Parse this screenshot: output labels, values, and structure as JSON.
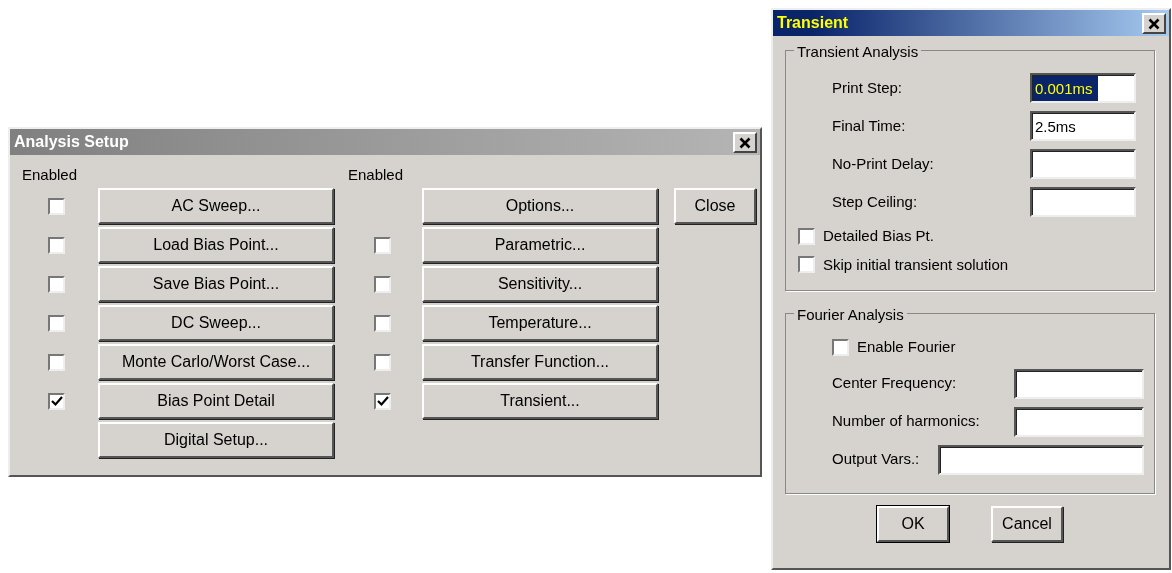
{
  "analysis_setup": {
    "title": "Analysis Setup",
    "left_column": {
      "header": "Enabled",
      "rows": [
        {
          "kind": "toggle",
          "label": "AC Sweep...",
          "checked": false
        },
        {
          "kind": "toggle",
          "label": "Load Bias Point...",
          "checked": false
        },
        {
          "kind": "toggle",
          "label": "Save Bias Point...",
          "checked": false
        },
        {
          "kind": "toggle",
          "label": "DC Sweep...",
          "checked": false
        },
        {
          "kind": "toggle",
          "label": "Monte Carlo/Worst Case...",
          "checked": false
        },
        {
          "kind": "toggle",
          "label": "Bias Point Detail",
          "checked": true
        },
        {
          "kind": "button",
          "label": "Digital Setup..."
        }
      ]
    },
    "right_column": {
      "header": "Enabled",
      "rows": [
        {
          "kind": "button",
          "label": "Options..."
        },
        {
          "kind": "toggle",
          "label": "Parametric...",
          "checked": false
        },
        {
          "kind": "toggle",
          "label": "Sensitivity...",
          "checked": false
        },
        {
          "kind": "toggle",
          "label": "Temperature...",
          "checked": false
        },
        {
          "kind": "toggle",
          "label": "Transfer Function...",
          "checked": false
        },
        {
          "kind": "toggle",
          "label": "Transient...",
          "checked": true
        }
      ]
    },
    "close_button": "Close"
  },
  "transient": {
    "title": "Transient",
    "transient_analysis": {
      "title": "Transient Analysis",
      "fields": [
        {
          "label": "Print Step:",
          "value": "0.001ms",
          "selected": true
        },
        {
          "label": "Final Time:",
          "value": "2.5ms",
          "selected": false
        },
        {
          "label": "No-Print Delay:",
          "selected": false
        },
        {
          "label": "Step Ceiling:",
          "selected": false
        }
      ],
      "checkboxes": [
        {
          "label": "Detailed Bias Pt.",
          "checked": false
        },
        {
          "label": "Skip initial transient solution",
          "checked": false
        }
      ]
    },
    "fourier_analysis": {
      "title": "Fourier Analysis",
      "checkbox": {
        "label": "Enable Fourier",
        "checked": false
      },
      "fields": [
        {
          "label": "Center Frequency:"
        },
        {
          "label": "Number of harmonics:"
        },
        {
          "label": "Output Vars.:",
          "wide": true
        }
      ]
    },
    "buttons": [
      {
        "label": "OK",
        "default": true
      },
      {
        "label": "Cancel",
        "default": false
      }
    ]
  }
}
